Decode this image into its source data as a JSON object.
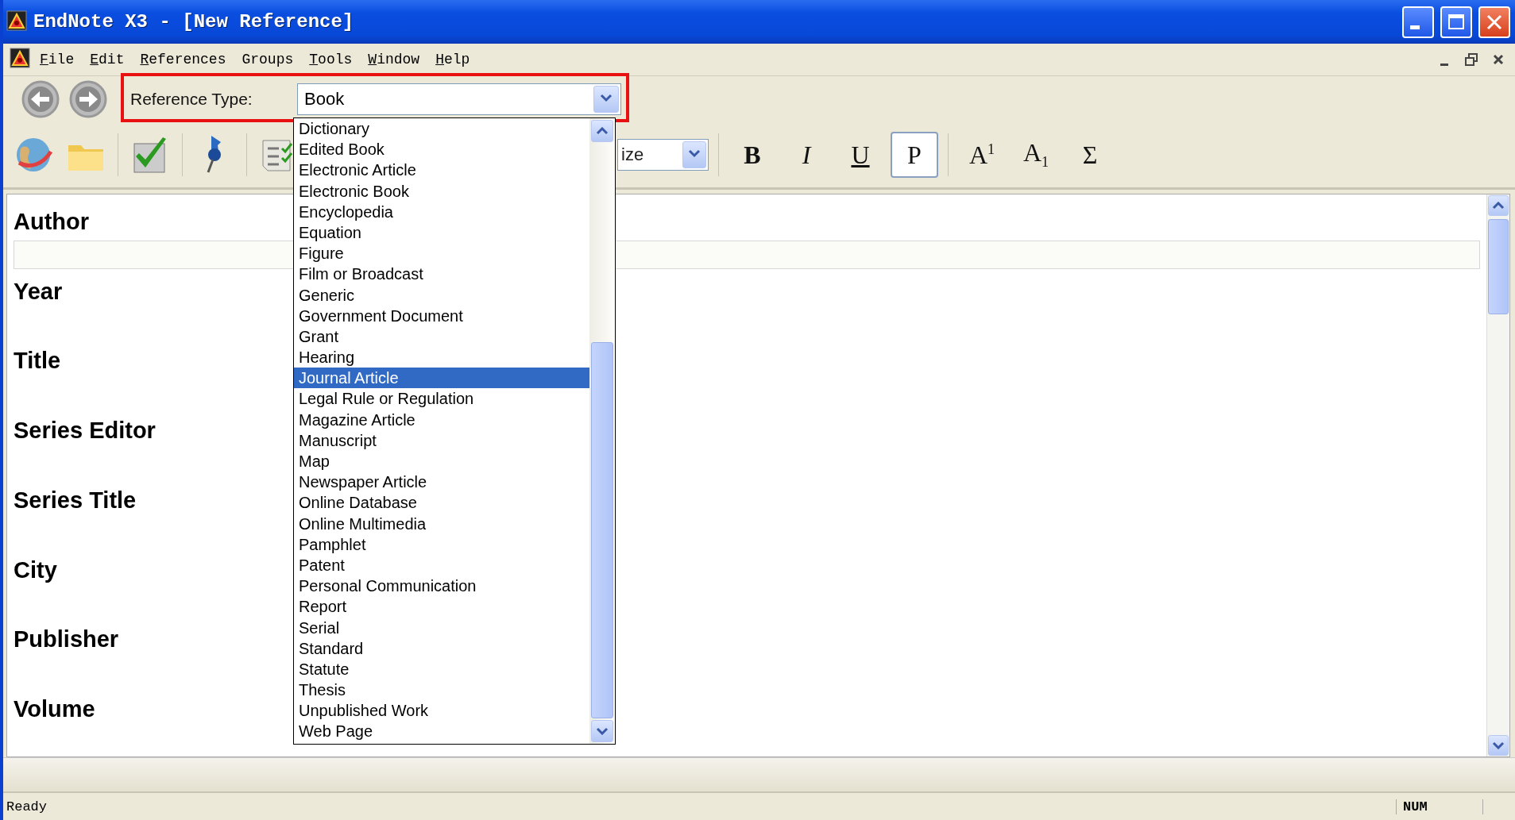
{
  "window": {
    "title": "EndNote X3 - [New Reference]"
  },
  "menu": [
    {
      "label": "File",
      "underlined": true
    },
    {
      "label": "Edit",
      "underlined": true
    },
    {
      "label": "References",
      "underlined": true
    },
    {
      "label": "Groups",
      "underlined": false
    },
    {
      "label": "Tools",
      "underlined": true
    },
    {
      "label": "Window",
      "underlined": true
    },
    {
      "label": "Help",
      "underlined": true
    }
  ],
  "reference_type": {
    "label": "Reference Type:",
    "value": "Book",
    "options": [
      {
        "label": "Dictionary",
        "selected": false
      },
      {
        "label": "Edited Book",
        "selected": false
      },
      {
        "label": "Electronic Article",
        "selected": false
      },
      {
        "label": "Electronic Book",
        "selected": false
      },
      {
        "label": "Encyclopedia",
        "selected": false
      },
      {
        "label": "Equation",
        "selected": false
      },
      {
        "label": "Figure",
        "selected": false
      },
      {
        "label": "Film or Broadcast",
        "selected": false
      },
      {
        "label": "Generic",
        "selected": false
      },
      {
        "label": "Government Document",
        "selected": false
      },
      {
        "label": "Grant",
        "selected": false
      },
      {
        "label": "Hearing",
        "selected": false
      },
      {
        "label": "Journal Article",
        "selected": true
      },
      {
        "label": "Legal Rule or Regulation",
        "selected": false
      },
      {
        "label": "Magazine Article",
        "selected": false
      },
      {
        "label": "Manuscript",
        "selected": false
      },
      {
        "label": "Map",
        "selected": false
      },
      {
        "label": "Newspaper Article",
        "selected": false
      },
      {
        "label": "Online Database",
        "selected": false
      },
      {
        "label": "Online Multimedia",
        "selected": false
      },
      {
        "label": "Pamphlet",
        "selected": false
      },
      {
        "label": "Patent",
        "selected": false
      },
      {
        "label": "Personal Communication",
        "selected": false
      },
      {
        "label": "Report",
        "selected": false
      },
      {
        "label": "Serial",
        "selected": false
      },
      {
        "label": "Standard",
        "selected": false
      },
      {
        "label": "Statute",
        "selected": false
      },
      {
        "label": "Thesis",
        "selected": false
      },
      {
        "label": "Unpublished Work",
        "selected": false
      },
      {
        "label": "Web Page",
        "selected": false
      }
    ]
  },
  "format_toolbar": {
    "size_field": "ize",
    "buttons": [
      {
        "label": "B",
        "kind": "bold",
        "selected": false
      },
      {
        "label": "I",
        "kind": "italic",
        "selected": false
      },
      {
        "label": "U",
        "kind": "underline",
        "selected": false
      },
      {
        "label": "P",
        "kind": "plain",
        "selected": true
      },
      {
        "label": "A$^{1}$",
        "kind": "superscript",
        "selected": false
      },
      {
        "label": "A$_{1}$",
        "kind": "subscript",
        "selected": false
      },
      {
        "label": "Σ",
        "kind": "symbol",
        "selected": false
      }
    ]
  },
  "fields": [
    {
      "label": "Author",
      "kind": "input"
    },
    {
      "label": "Year",
      "kind": "label"
    },
    {
      "label": "Title",
      "kind": "label"
    },
    {
      "label": "Series Editor",
      "kind": "label"
    },
    {
      "label": "Series Title",
      "kind": "label"
    },
    {
      "label": "City",
      "kind": "label"
    },
    {
      "label": "Publisher",
      "kind": "label"
    },
    {
      "label": "Volume",
      "kind": "label"
    }
  ],
  "status_bar": {
    "text": "Ready",
    "indicator": "NUM"
  }
}
